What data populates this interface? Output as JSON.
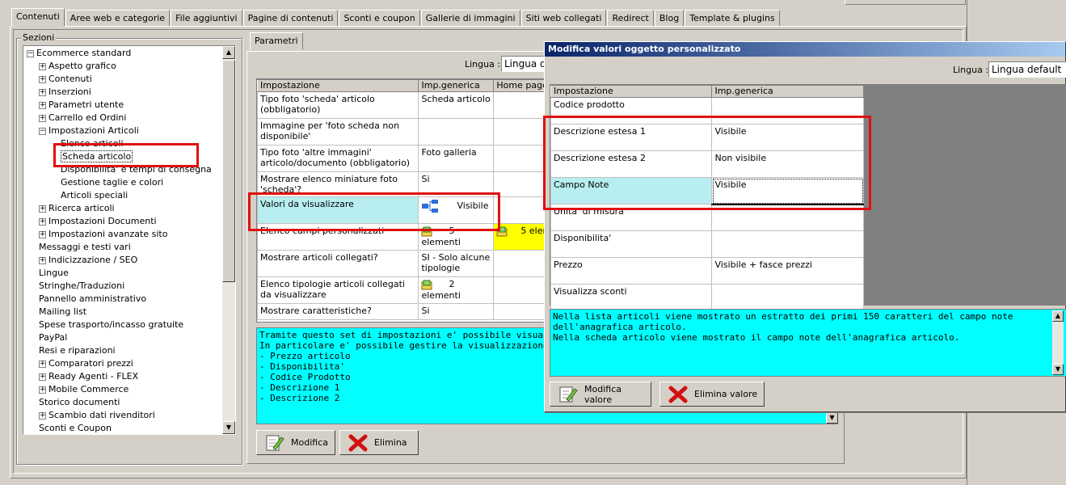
{
  "tabs": [
    "Contenuti",
    "Aree web e categorie",
    "File aggiuntivi",
    "Pagine di contenuti",
    "Sconti e coupon",
    "Gallerie di immagini",
    "Siti web collegati",
    "Redirect",
    "Blog",
    "Template & plugins"
  ],
  "sections": {
    "legend": "Sezioni",
    "items": [
      {
        "label": "Ecommerce standard",
        "level": 0,
        "exp": "-"
      },
      {
        "label": "Aspetto grafico",
        "level": 1,
        "exp": "+"
      },
      {
        "label": "Contenuti",
        "level": 1,
        "exp": "+"
      },
      {
        "label": "Inserzioni",
        "level": 1,
        "exp": "+"
      },
      {
        "label": "Parametri utente",
        "level": 1,
        "exp": "+"
      },
      {
        "label": "Carrello ed Ordini",
        "level": 1,
        "exp": "+"
      },
      {
        "label": "Impostazioni Articoli",
        "level": 1,
        "exp": "-"
      },
      {
        "label": "Elenco articoli",
        "level": 2,
        "exp": ""
      },
      {
        "label": "Scheda articolo",
        "level": 2,
        "exp": ""
      },
      {
        "label": "Disponibilita' e tempi di consegna",
        "level": 2,
        "exp": ""
      },
      {
        "label": "Gestione taglie e colori",
        "level": 2,
        "exp": ""
      },
      {
        "label": "Articoli speciali",
        "level": 2,
        "exp": ""
      },
      {
        "label": "Ricerca articoli",
        "level": 1,
        "exp": "+"
      },
      {
        "label": "Impostazioni Documenti",
        "level": 1,
        "exp": "+"
      },
      {
        "label": "Impostazioni avanzate sito",
        "level": 1,
        "exp": "+"
      },
      {
        "label": "Messaggi e testi vari",
        "level": 1,
        "exp": ""
      },
      {
        "label": "Indicizzazione / SEO",
        "level": 1,
        "exp": "+"
      },
      {
        "label": "Lingue",
        "level": 1,
        "exp": ""
      },
      {
        "label": "Stringhe/Traduzioni",
        "level": 1,
        "exp": ""
      },
      {
        "label": "Pannello amministrativo",
        "level": 1,
        "exp": ""
      },
      {
        "label": "Mailing list",
        "level": 1,
        "exp": ""
      },
      {
        "label": "Spese trasporto/incasso gratuite",
        "level": 1,
        "exp": ""
      },
      {
        "label": "PayPal",
        "level": 1,
        "exp": ""
      },
      {
        "label": "Resi e riparazioni",
        "level": 1,
        "exp": ""
      },
      {
        "label": "Comparatori prezzi",
        "level": 1,
        "exp": "+"
      },
      {
        "label": "Ready Agenti - FLEX",
        "level": 1,
        "exp": "+"
      },
      {
        "label": "Mobile Commerce",
        "level": 1,
        "exp": "+"
      },
      {
        "label": "Storico documenti",
        "level": 1,
        "exp": ""
      },
      {
        "label": "Scambio dati rivenditori",
        "level": 1,
        "exp": "+"
      },
      {
        "label": "Sconti e Coupon",
        "level": 1,
        "exp": ""
      }
    ]
  },
  "params": {
    "tab": "Parametri",
    "lingua_label": "Lingua :",
    "lingua_value": "Lingua d",
    "headers": [
      "Impostazione",
      "Imp.generica",
      "Home page"
    ],
    "rows": [
      {
        "name": "Tipo foto 'scheda' articolo (obbligatorio)",
        "value": "Scheda articolo",
        "bold": true
      },
      {
        "name": "Immagine per 'foto scheda non disponibile'",
        "value": ""
      },
      {
        "name": "Tipo foto 'altre immagini' articolo/documento (obbligatorio)",
        "value": "Foto galleria",
        "bold": true
      },
      {
        "name": "Mostrare elenco miniature foto 'scheda'?",
        "value": "Si"
      },
      {
        "name": "Valori da visualizzare",
        "value": "Visibile",
        "selected": true
      },
      {
        "name": "Elenco campi personalizzati",
        "value": "5 elementi",
        "home": "5 elem"
      },
      {
        "name": "Mostrare articoli collegati?",
        "value": "SI - Solo alcune tipologie"
      },
      {
        "name": "Elenco tipologie articoli collegati da visualizzare",
        "value": "2 elementi"
      },
      {
        "name": "Mostrare caratteristiche?",
        "value": "Si"
      }
    ],
    "description": "Tramite questo set di impostazioni e' possibile visualizzare o n\nIn particolare e' possibile gestire la visualizzazione di:\n- Prezzo articolo\n- Disponibilita'\n- Codice Prodotto\n- Descrizione 1\n- Descrizione 2",
    "btn_modifica": "Modifica",
    "btn_elimina": "Elimina"
  },
  "dialog": {
    "title": "Modifica valori oggetto personalizzato",
    "lingua_label": "Lingua :",
    "lingua_value": "Lingua default",
    "headers": [
      "Impostazione",
      "Imp.generica"
    ],
    "rows": [
      {
        "name": "Codice prodotto",
        "value": ""
      },
      {
        "name": "Descrizione estesa 1",
        "value": "Visibile"
      },
      {
        "name": "Descrizione estesa 2",
        "value": "Non visibile"
      },
      {
        "name": "Campo Note",
        "value": "Visibile",
        "selected": true
      },
      {
        "name": "Unita' di misura",
        "value": ""
      },
      {
        "name": "Disponibilita'",
        "value": ""
      },
      {
        "name": "Prezzo",
        "value": "Visibile + fasce prezzi"
      },
      {
        "name": "Visualizza sconti",
        "value": ""
      }
    ],
    "description": "Nella lista articoli viene mostrato un estratto dei primi 150 caratteri del campo note dell'anagrafica articolo.\nNella scheda articolo viene mostrato il campo note dell'anagrafica articolo.",
    "btn_modifica": "Modifica valore",
    "btn_elimina": "Elimina valore"
  },
  "colors": {
    "highlight_red": "#e01010",
    "selection": "#b8eef0",
    "description_bg": "#00ffff",
    "title_blue": "#0a246a"
  }
}
